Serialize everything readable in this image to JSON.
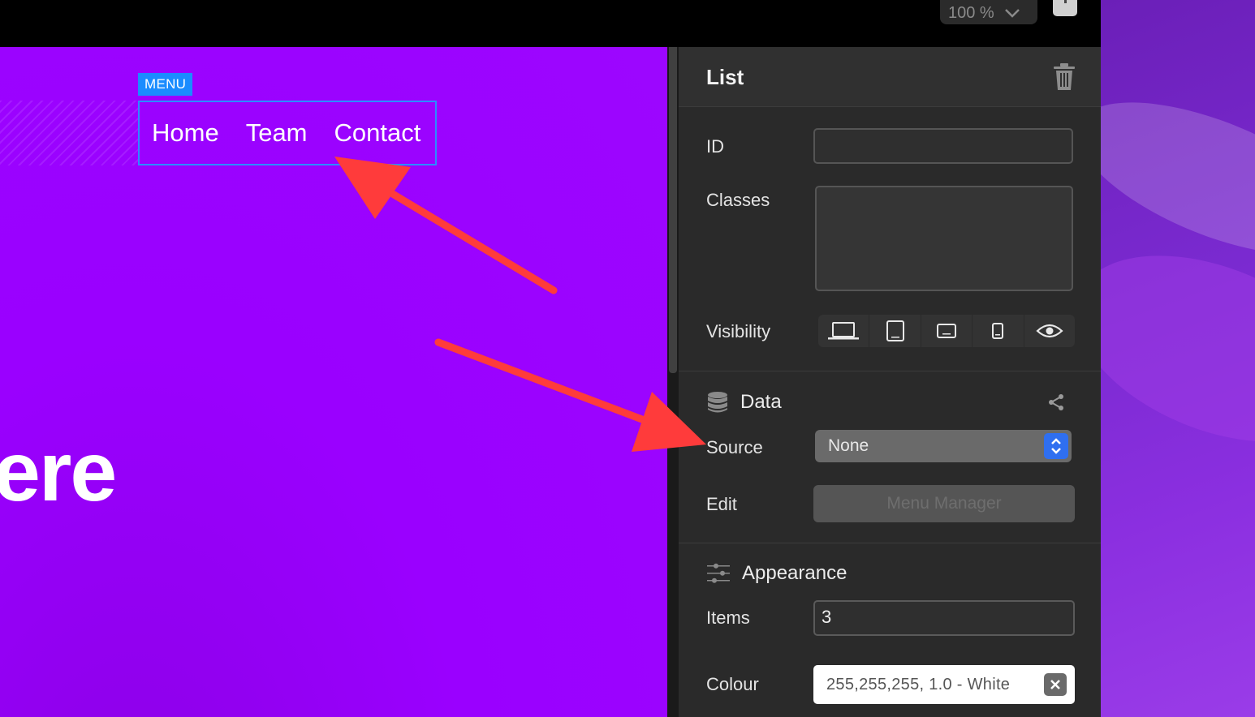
{
  "toolbar": {
    "zoom_label": "100 %"
  },
  "canvas": {
    "menu_badge": "MENU",
    "menu_items": [
      "Home",
      "Team",
      "Contact"
    ],
    "hero_text": "ere"
  },
  "inspector": {
    "title": "List",
    "id_label": "ID",
    "id_value": "",
    "classes_label": "Classes",
    "classes_value": "",
    "visibility_label": "Visibility",
    "visibility_icons": [
      "laptop-icon",
      "tablet-icon",
      "landscape-phone-icon",
      "phone-icon",
      "eye-icon"
    ],
    "data_section": {
      "title": "Data",
      "source_label": "Source",
      "source_value": "None",
      "edit_label": "Edit",
      "edit_button": "Menu Manager"
    },
    "appearance_section": {
      "title": "Appearance",
      "items_label": "Items",
      "items_value": "3",
      "colour_label": "Colour",
      "colour_value": "255,255,255, 1.0 - White"
    }
  },
  "colors": {
    "canvas_bg": "#9c06ff",
    "selection_blue": "#2b8cff",
    "panel_bg": "#2a2a2a",
    "annotation_red": "#ff3b3b",
    "stepper_blue": "#2f6ff0"
  }
}
